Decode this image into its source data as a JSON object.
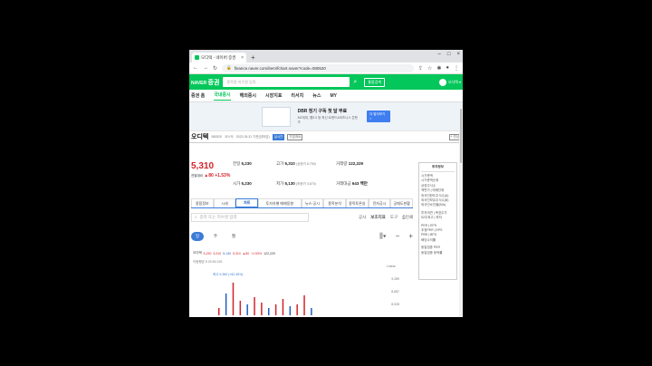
{
  "browser": {
    "tab_title": "오디텍 - 네이버 증권",
    "tab_close": "×",
    "new_tab": "+",
    "url": "finance.naver.com/item/fchart.naver?code=080520"
  },
  "gnb": {
    "logo": "NAVER",
    "logo_service": "증권",
    "search_placeholder": "종목명·지수명 입력",
    "search_button": "통합검색",
    "user": "오디텍 ▾",
    "menu": [
      "증권 홈",
      "국내증시",
      "해외증시",
      "시장지표",
      "리서치",
      "뉴스",
      "MY"
    ]
  },
  "banner": {
    "title": "DBR 정기 구독 첫 달 무료",
    "subtitle": "MZ세대, 웹3.0 등 최신 트렌드&비즈니스 콘텐츠",
    "button": "더 알아보기 >"
  },
  "stock": {
    "name": "오디텍",
    "code": "080520",
    "market": "코스닥",
    "date": "2022.05.31 기준(장마감)",
    "tag1": "실시간",
    "tag2": "기업개요",
    "add": "+ 관심",
    "price": "5,310",
    "prev_label": "전일대비",
    "change": "▲80",
    "change_pct": "+1.53%"
  },
  "quote": {
    "prev_close_label": "전일",
    "prev_close": "5,230",
    "high_label": "고가",
    "high": "5,310",
    "upper_label": "(상한가 6,790)",
    "volume_label": "거래량",
    "volume": "122,229",
    "open_label": "시가",
    "open": "5,230",
    "low_label": "저가",
    "low": "5,130",
    "lower_label": "(하한가 3,670)",
    "amount_label": "거래대금",
    "amount": "643 백만"
  },
  "side_panel": {
    "title": "투자정보",
    "items": [
      "시가총액",
      "시가총액순위",
      "상장주식수",
      "액면가 | 매매단위",
      "외국인한도주식수(A)",
      "외국인보유주식수(B)",
      "외국인소진율(B/A)",
      "투자의견 | 목표주가",
      "52주최고 | 최저",
      "PER | EPS",
      "추정PER | EPS",
      "PBR | BPS",
      "배당수익률",
      "동일업종 PER",
      "동일업종 등락률"
    ]
  },
  "subtabs": [
    "종합정보",
    "시세",
    "차트",
    "투자자별 매매동향",
    "뉴스·공시",
    "종목분석",
    "종목토론실",
    "전자공시",
    "공매도현황"
  ],
  "chart_toolbar": {
    "search_placeholder": "종목 또는 지수명 입력",
    "right_items": [
      "공시",
      "보조지표",
      "도구",
      "인쇄"
    ],
    "periods": [
      "일",
      "주",
      "월"
    ],
    "minus": "−",
    "plus": "+"
  },
  "legend": {
    "name": "오디텍",
    "open": "5,230",
    "high": "5,310",
    "low": "5,130",
    "close": "5,310",
    "change": "▲80",
    "pct": "+1.53%",
    "volume": "122,229",
    "ma": "이동평균 5 20 60 120",
    "linear": "Linear",
    "annot": "최고 9,350 (+62.45%)"
  },
  "chart_data": {
    "type": "bar",
    "y_labels": [
      "9,289",
      "8,687",
      "8,028"
    ],
    "values": [
      0.2,
      0.6,
      0.9,
      0.4,
      0.3,
      0.5,
      0.35,
      0.2,
      0.3,
      0.45,
      0.25,
      0.3,
      0.55,
      0.2
    ],
    "colors": {
      "up": "#d2232a",
      "down": "#1d5fbf"
    }
  }
}
